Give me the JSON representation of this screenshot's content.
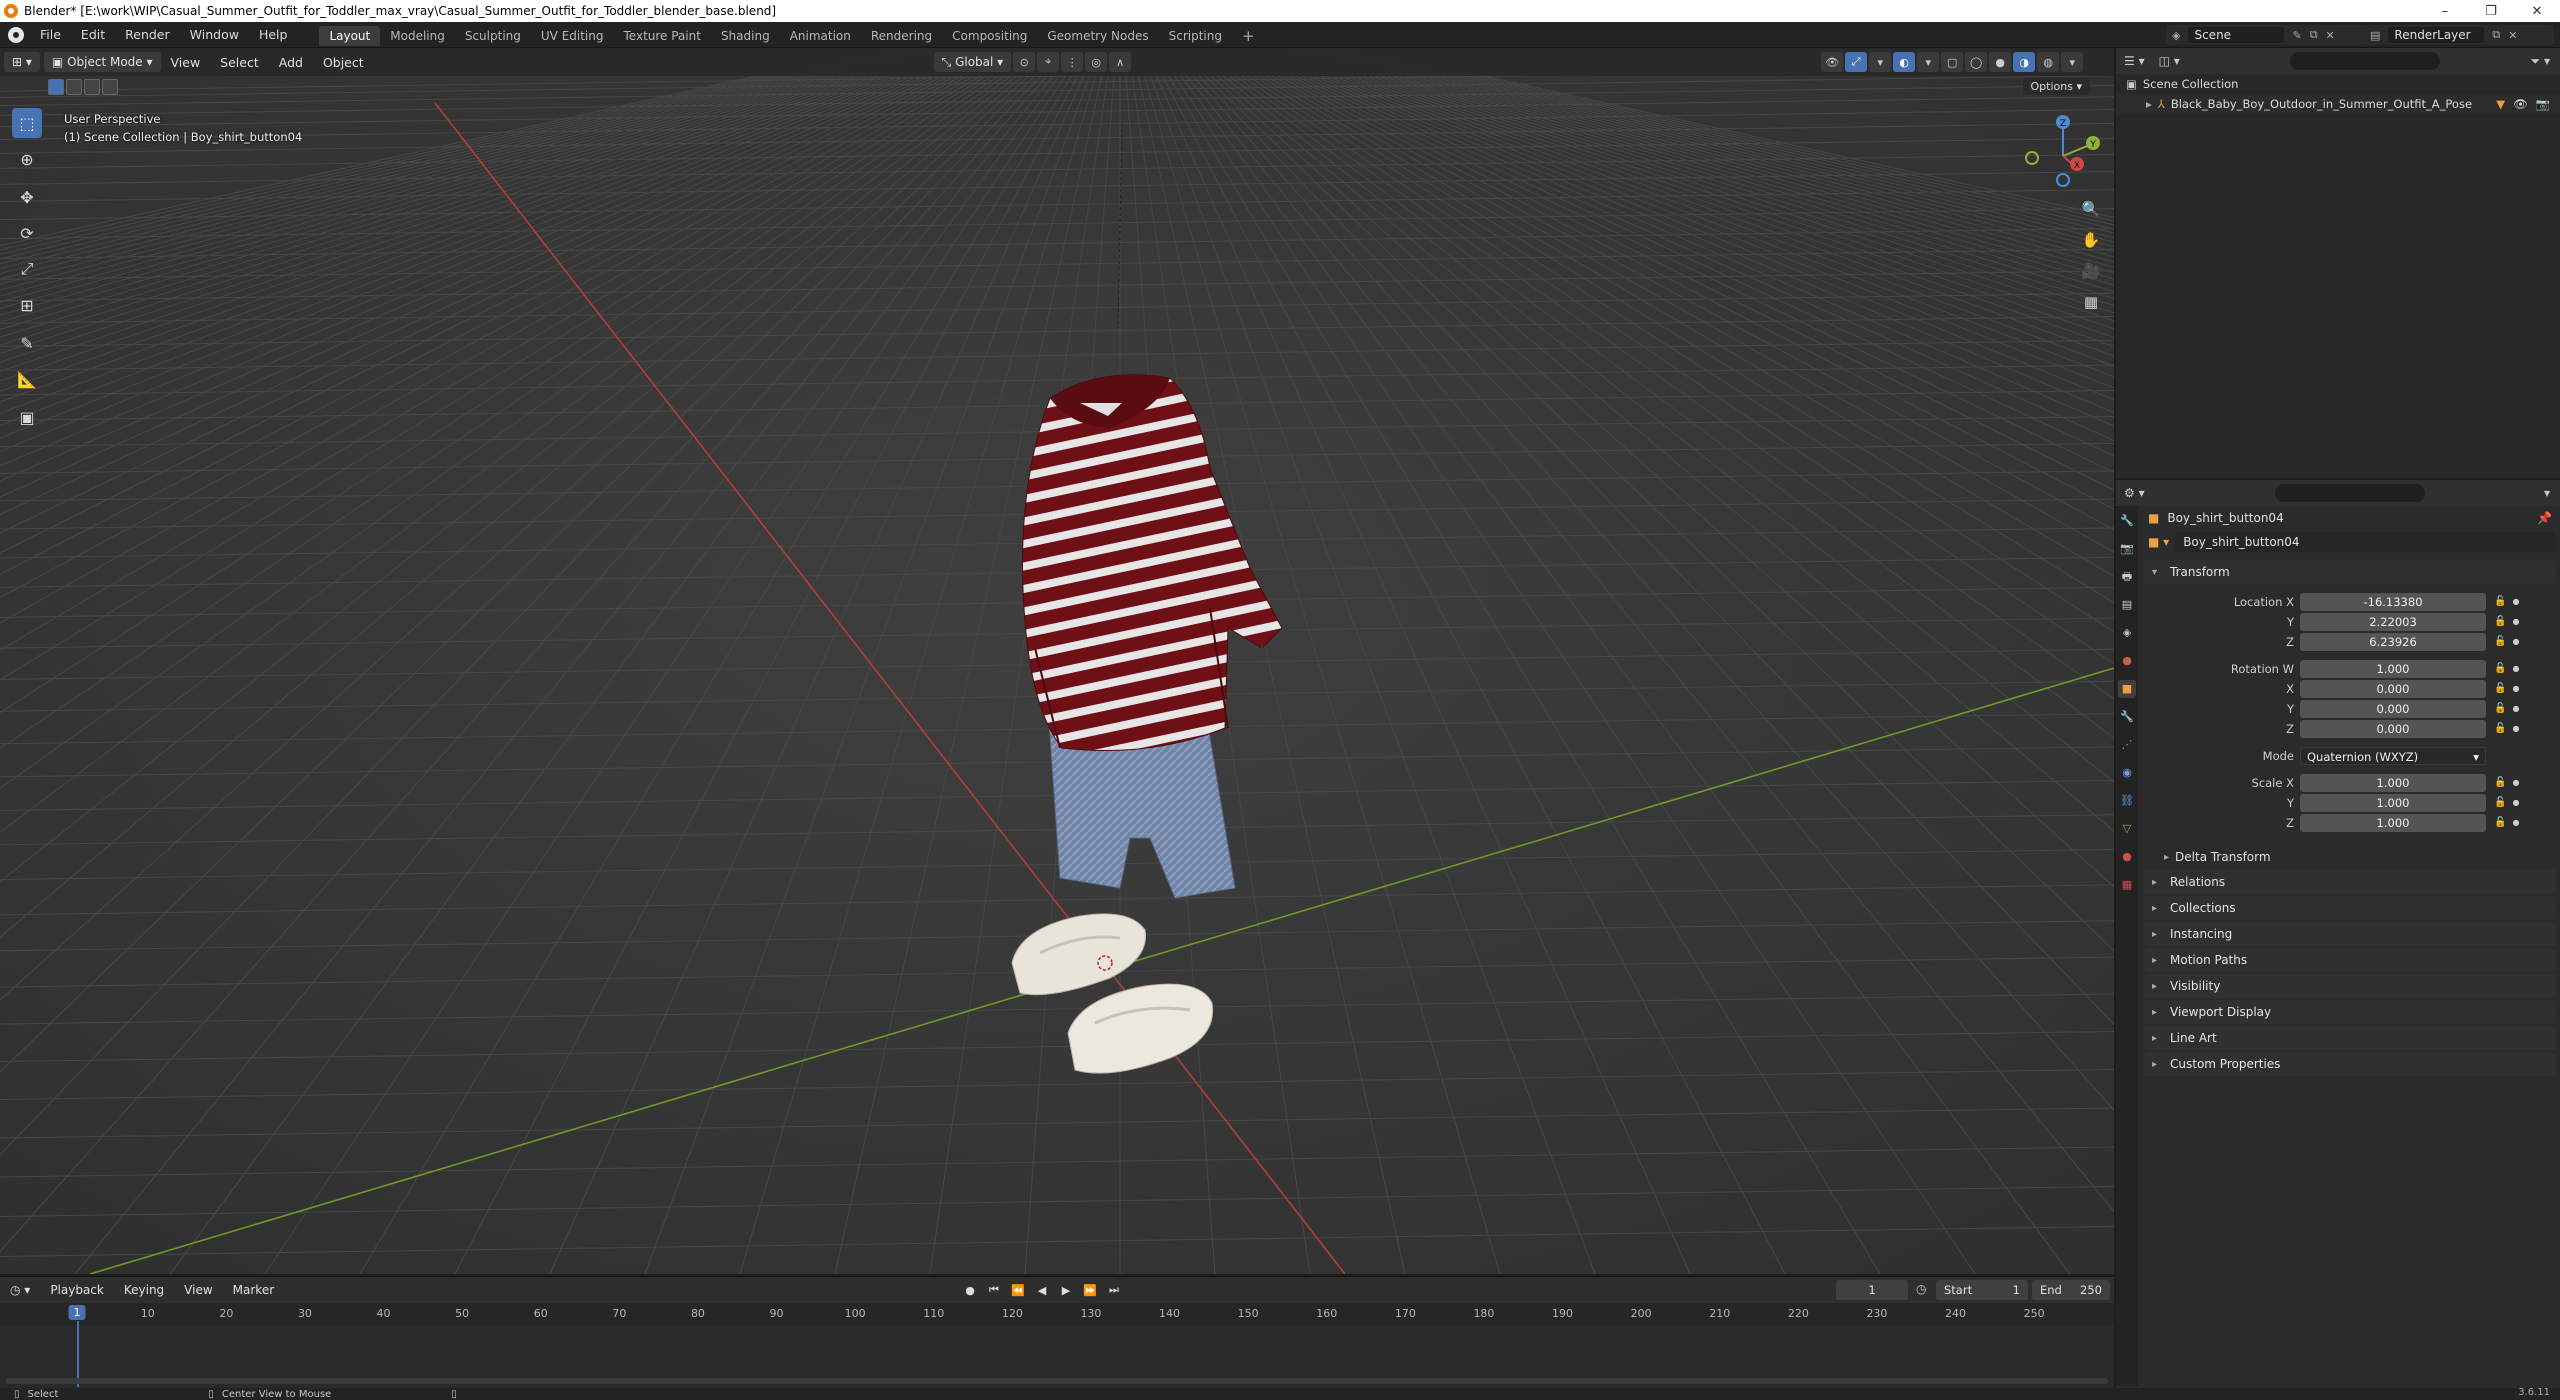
{
  "window": {
    "title": "Blender* [E:\\work\\WIP\\Casual_Summer_Outfit_for_Toddler_max_vray\\Casual_Summer_Outfit_for_Toddler_blender_base.blend]",
    "minimize": "–",
    "maximize": "❐",
    "close": "✕"
  },
  "menu": {
    "file": "File",
    "edit": "Edit",
    "render": "Render",
    "window": "Window",
    "help": "Help"
  },
  "workspaces": [
    "Layout",
    "Modeling",
    "Sculpting",
    "UV Editing",
    "Texture Paint",
    "Shading",
    "Animation",
    "Rendering",
    "Compositing",
    "Geometry Nodes",
    "Scripting"
  ],
  "add_workspace": "+",
  "scene": {
    "label": "Scene",
    "layer": "RenderLayer"
  },
  "viewport": {
    "mode": "Object Mode",
    "menus": [
      "View",
      "Select",
      "Add",
      "Object"
    ],
    "orientation": "Global",
    "options": "Options",
    "info_line1": "User Perspective",
    "info_line2": "(1) Scene Collection | Boy_shirt_button04",
    "gizmo_axes": {
      "x": "X",
      "y": "Y",
      "z": "Z"
    }
  },
  "outliner": {
    "search_placeholder": "",
    "collection": "Scene Collection",
    "object": "Black_Baby_Boy_Outdoor_in_Summer_Outfit_A_Pose"
  },
  "properties": {
    "object_name": "Boy_shirt_button04",
    "data_name": "Boy_shirt_button04",
    "transform_title": "Transform",
    "location": {
      "label": "Location X",
      "x": "-16.13380",
      "y": "2.22003",
      "z": "6.23926"
    },
    "rotation": {
      "label": "Rotation W",
      "w": "1.000",
      "x": "0.000",
      "y": "0.000",
      "z": "0.000"
    },
    "mode": {
      "label": "Mode",
      "value": "Quaternion (WXYZ)"
    },
    "scale": {
      "label": "Scale X",
      "x": "1.000",
      "y": "1.000",
      "z": "1.000"
    },
    "axis_labels": {
      "y": "Y",
      "z": "Z",
      "x": "X"
    },
    "delta": "Delta Transform",
    "sections": [
      "Relations",
      "Collections",
      "Instancing",
      "Motion Paths",
      "Visibility",
      "Viewport Display",
      "Line Art",
      "Custom Properties"
    ]
  },
  "timeline": {
    "menus": [
      "Playback",
      "Keying",
      "View",
      "Marker"
    ],
    "current_frame": "1",
    "start_label": "Start",
    "start": "1",
    "end_label": "End",
    "end": "250",
    "ticks": [
      "10",
      "20",
      "30",
      "40",
      "50",
      "60",
      "70",
      "80",
      "90",
      "100",
      "110",
      "120",
      "130",
      "140",
      "150",
      "160",
      "170",
      "180",
      "190",
      "200",
      "210",
      "220",
      "230",
      "240",
      "250"
    ],
    "playhead_label": "1"
  },
  "statusbar": {
    "select": "Select",
    "center": "Center View to Mouse",
    "version": "3.6.11"
  }
}
